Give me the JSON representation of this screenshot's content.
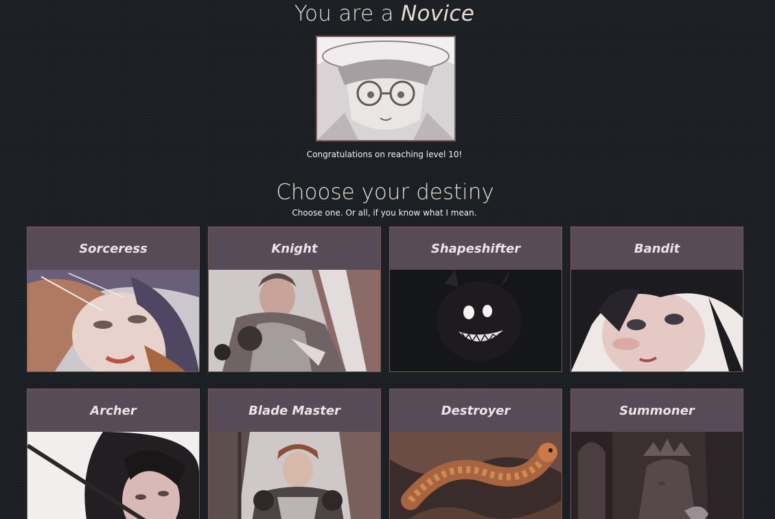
{
  "header": {
    "rank_prefix": "You are a ",
    "rank_name": "Novice",
    "congrats": "Congratulations on reaching level 10!"
  },
  "destiny": {
    "title": "Choose your destiny",
    "subtitle": "Choose one. Or all, if you know what I mean."
  },
  "classes": [
    {
      "name": "Sorceress"
    },
    {
      "name": "Knight"
    },
    {
      "name": "Shapeshifter"
    },
    {
      "name": "Bandit"
    },
    {
      "name": "Archer"
    },
    {
      "name": "Blade Master"
    },
    {
      "name": "Destroyer"
    },
    {
      "name": "Summoner"
    }
  ],
  "colors": {
    "background": "#1b1e22",
    "card_header": "#574b58",
    "card_border": "#7b5758",
    "title_text": "#e9dcd8"
  }
}
